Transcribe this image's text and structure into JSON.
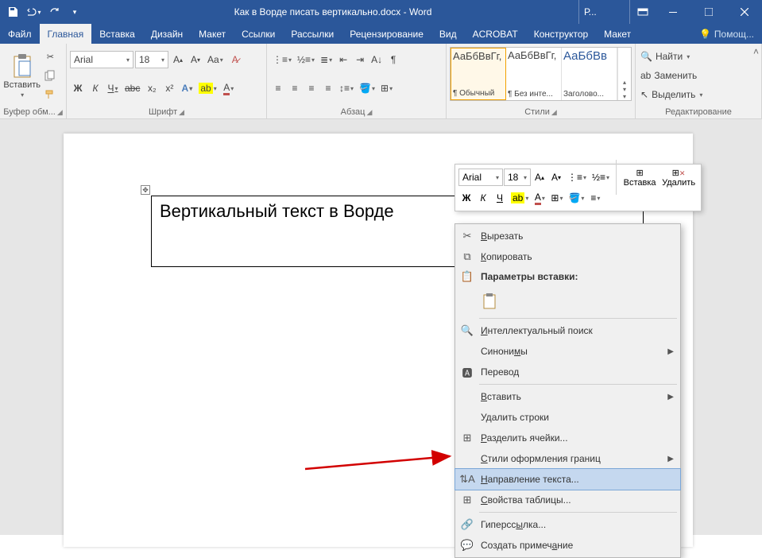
{
  "titlebar": {
    "title": "Как в Ворде писать вертикально.docx - Word",
    "p_indicator": "Р..."
  },
  "tabs": {
    "file": "Файл",
    "home": "Главная",
    "insert": "Вставка",
    "design": "Дизайн",
    "layout": "Макет",
    "references": "Ссылки",
    "mailings": "Рассылки",
    "review": "Рецензирование",
    "view": "Вид",
    "acrobat": "ACROBAT",
    "table_design": "Конструктор",
    "table_layout": "Макет",
    "help_placeholder": "Помощ..."
  },
  "ribbon": {
    "clipboard": {
      "paste": "Вставить",
      "label": "Буфер обм..."
    },
    "font": {
      "label": "Шрифт",
      "name": "Arial",
      "size": "18",
      "bold": "Ж",
      "italic": "К",
      "underline": "Ч",
      "strike": "abc",
      "sub": "x₂",
      "sup": "x²",
      "case": "Aa",
      "clear": "A"
    },
    "para": {
      "label": "Абзац"
    },
    "styles": {
      "label": "Стили",
      "items": [
        {
          "preview": "АаБбВвГг,",
          "name": "¶ Обычный"
        },
        {
          "preview": "АаБбВвГг,",
          "name": "¶ Без инте..."
        },
        {
          "preview": "АаБбВв",
          "name": "Заголово..."
        }
      ]
    },
    "editing": {
      "label": "Редактирование",
      "find": "Найти",
      "replace": "Заменить",
      "select": "Выделить"
    }
  },
  "document": {
    "table_text": "Вертикальный текст в Ворде"
  },
  "minibar": {
    "font": "Arial",
    "size": "18",
    "bold": "Ж",
    "italic": "К",
    "underline": "Ч",
    "insert": "Вставка",
    "delete": "Удалить"
  },
  "contextmenu": {
    "cut": "Вырезать",
    "copy": "Копировать",
    "paste_heading": "Параметры вставки:",
    "smart_lookup": "Интеллектуальный поиск",
    "synonyms": "Синонимы",
    "translate": "Перевод",
    "insert": "Вставить",
    "delete_rows": "Удалить строки",
    "split_cells": "Разделить ячейки...",
    "border_styles": "Стили оформления границ",
    "text_direction": "Направление текста...",
    "table_props": "Свойства таблицы...",
    "hyperlink": "Гиперссылка...",
    "new_comment": "Создать примечание"
  }
}
